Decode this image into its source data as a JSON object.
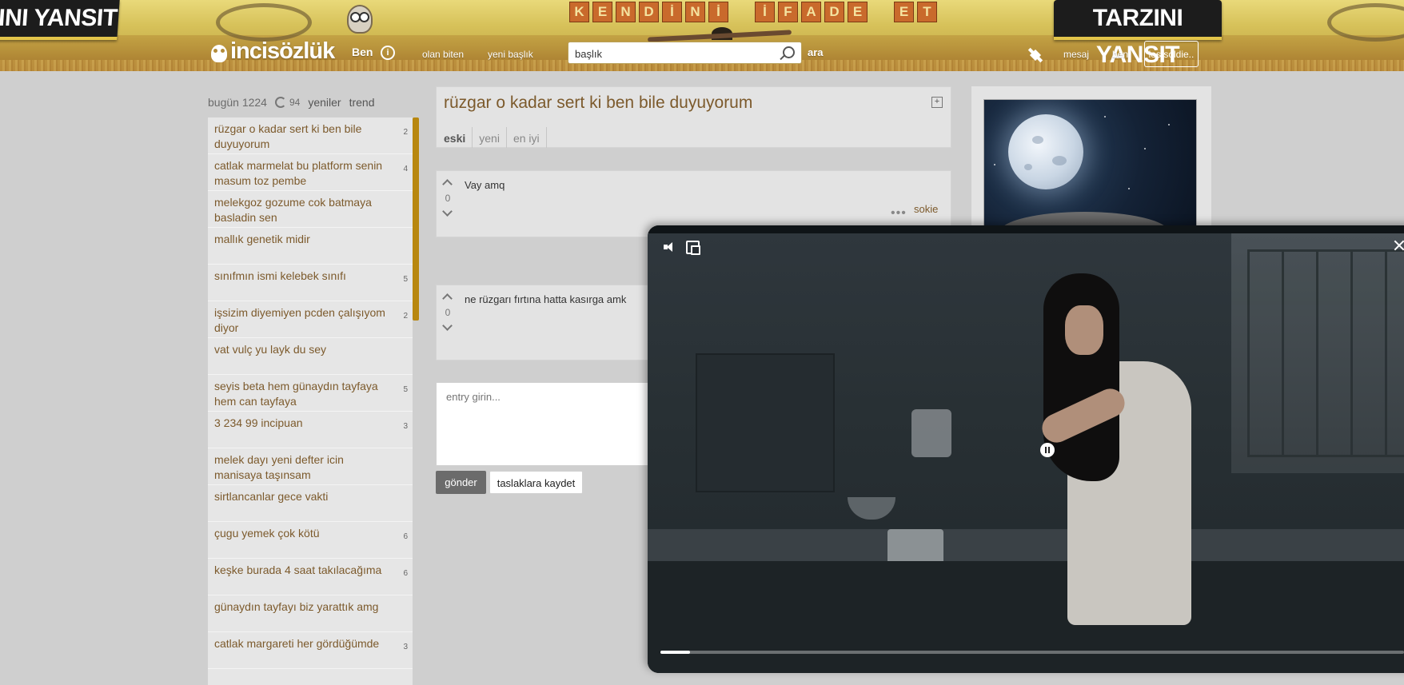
{
  "banner": {
    "left_sign": "INI YANSIT",
    "right_sign": "TARZINI YANSIT",
    "tagline_letters": [
      "K",
      "E",
      "N",
      "D",
      "İ",
      "N",
      "İ",
      " ",
      "İ",
      "F",
      "A",
      "D",
      "E",
      " ",
      "E",
      "T"
    ]
  },
  "header": {
    "logo": "incisözlük",
    "ben": "Ben",
    "olan_biten": "olan biten",
    "yeni_baslik": "yeni başlık",
    "search_value": "başlık",
    "ara": "ara",
    "mesaj": "mesaj",
    "ben_link": "ben",
    "username": "lostsoldie.."
  },
  "sidebar": {
    "today_label": "bugün 1224",
    "refresh_count": "94",
    "yeniler": "yeniler",
    "trend": "trend",
    "items": [
      {
        "title": "rüzgar o kadar sert ki ben bile duyuyorum",
        "count": "2"
      },
      {
        "title": "catlak marmelat bu platform senin masum toz pembe",
        "count": "4"
      },
      {
        "title": "melekgoz gozume cok batmaya basladin sen",
        "count": ""
      },
      {
        "title": "mallık genetik midir",
        "count": ""
      },
      {
        "title": "sınıfmın ismi kelebek sınıfı",
        "count": "5"
      },
      {
        "title": "işsizim diyemiyen pcden çalışıyom diyor",
        "count": "2"
      },
      {
        "title": "vat vulç yu layk du sey",
        "count": ""
      },
      {
        "title": "seyis beta hem günaydın tayfaya hem can tayfaya",
        "count": "5"
      },
      {
        "title": "3 234 99 incipuan",
        "count": "3"
      },
      {
        "title": "melek dayı yeni defter icin manisaya taşınsam",
        "count": ""
      },
      {
        "title": "sirtlancanlar gece vakti",
        "count": ""
      },
      {
        "title": "çugu yemek çok kötü",
        "count": "6"
      },
      {
        "title": "keşke burada 4 saat takılacağıma",
        "count": "6"
      },
      {
        "title": "günaydın tayfayı biz yarattık amg",
        "count": ""
      },
      {
        "title": "catlak margareti her gördüğümde",
        "count": "3"
      }
    ]
  },
  "topic": {
    "title": "rüzgar o kadar sert ki ben bile duyuyorum",
    "tabs": [
      "eski",
      "yeni",
      "en iyi"
    ]
  },
  "entries": [
    {
      "text": "Vay amq",
      "votes": "0",
      "author": "sokie"
    },
    {
      "text": "ne rüzgarı fırtına hatta kasırga amk",
      "votes": "0"
    }
  ],
  "compose": {
    "placeholder": "entry girin...",
    "send": "gönder",
    "save_draft": "taslaklara kaydet"
  },
  "video": {
    "progress_fraction": 0.04
  }
}
